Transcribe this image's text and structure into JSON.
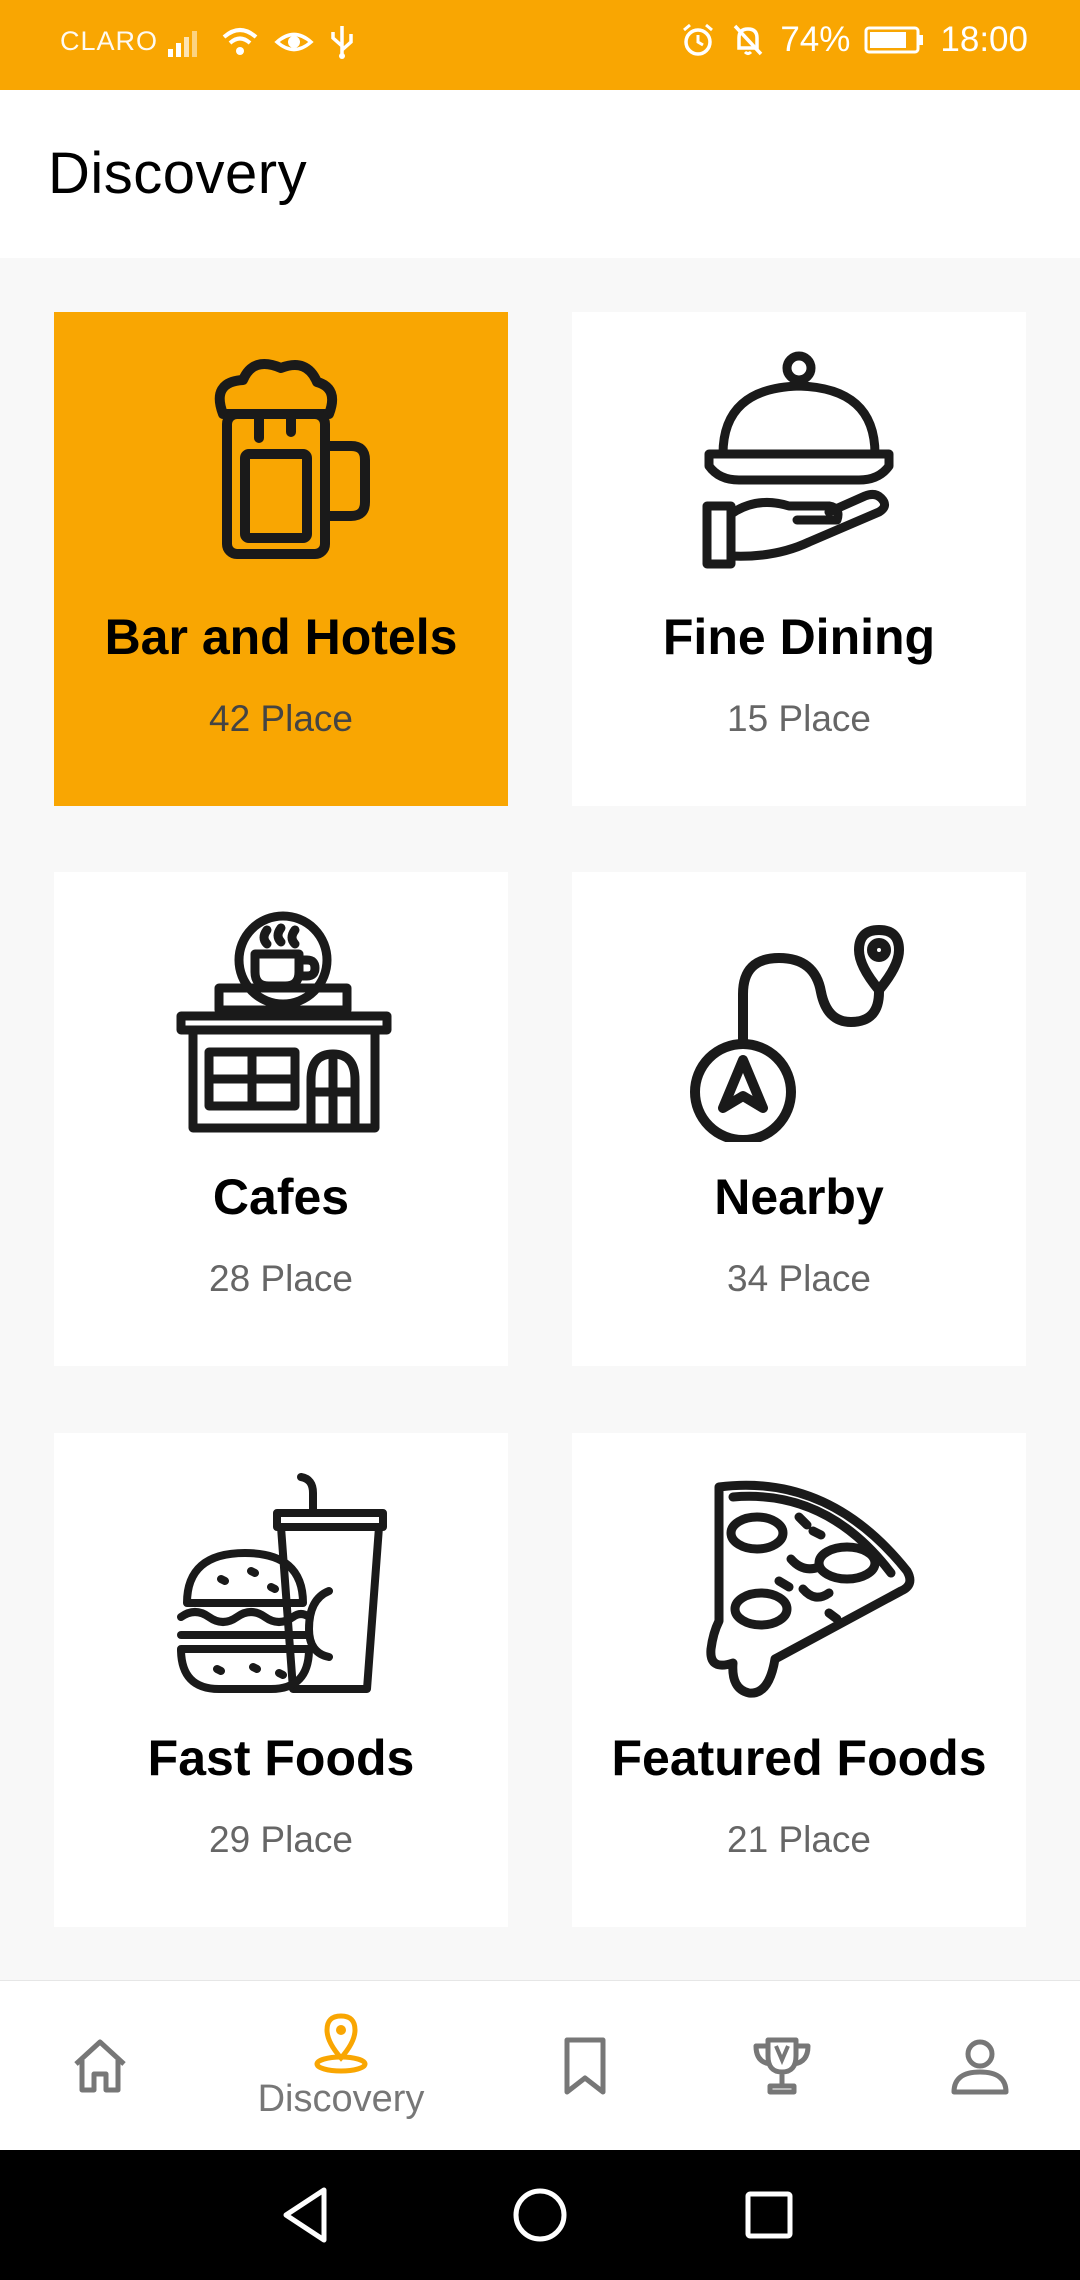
{
  "status_bar": {
    "carrier": "CLARO",
    "battery_percent": "74%",
    "time": "18:00",
    "icons": [
      "signal-icon",
      "wifi-icon",
      "eye-icon",
      "usb-icon",
      "alarm-icon",
      "mute-bell-icon",
      "battery-icon"
    ]
  },
  "header": {
    "title": "Discovery"
  },
  "categories": [
    {
      "title": "Bar and Hotels",
      "count": "42 Place",
      "icon": "beer-mug-icon",
      "active": true
    },
    {
      "title": "Fine Dining",
      "count": "15 Place",
      "icon": "cloche-hand-icon",
      "active": false
    },
    {
      "title": "Cafes",
      "count": "28 Place",
      "icon": "cafe-building-icon",
      "active": false
    },
    {
      "title": "Nearby",
      "count": "34 Place",
      "icon": "route-pin-icon",
      "active": false
    },
    {
      "title": "Fast Foods",
      "count": "29 Place",
      "icon": "burger-drink-icon",
      "active": false
    },
    {
      "title": "Featured Foods",
      "count": "21 Place",
      "icon": "pizza-slice-icon",
      "active": false
    }
  ],
  "bottom_nav": {
    "items": [
      {
        "icon": "home-icon",
        "label": ""
      },
      {
        "icon": "discovery-pin-icon",
        "label": "Discovery",
        "active": true
      },
      {
        "icon": "bookmark-icon",
        "label": ""
      },
      {
        "icon": "trophy-icon",
        "label": ""
      },
      {
        "icon": "profile-icon",
        "label": ""
      }
    ]
  },
  "colors": {
    "accent": "#f9a602",
    "card_bg": "#ffffff",
    "page_bg": "#f8f8f8",
    "muted_text": "#666666"
  }
}
